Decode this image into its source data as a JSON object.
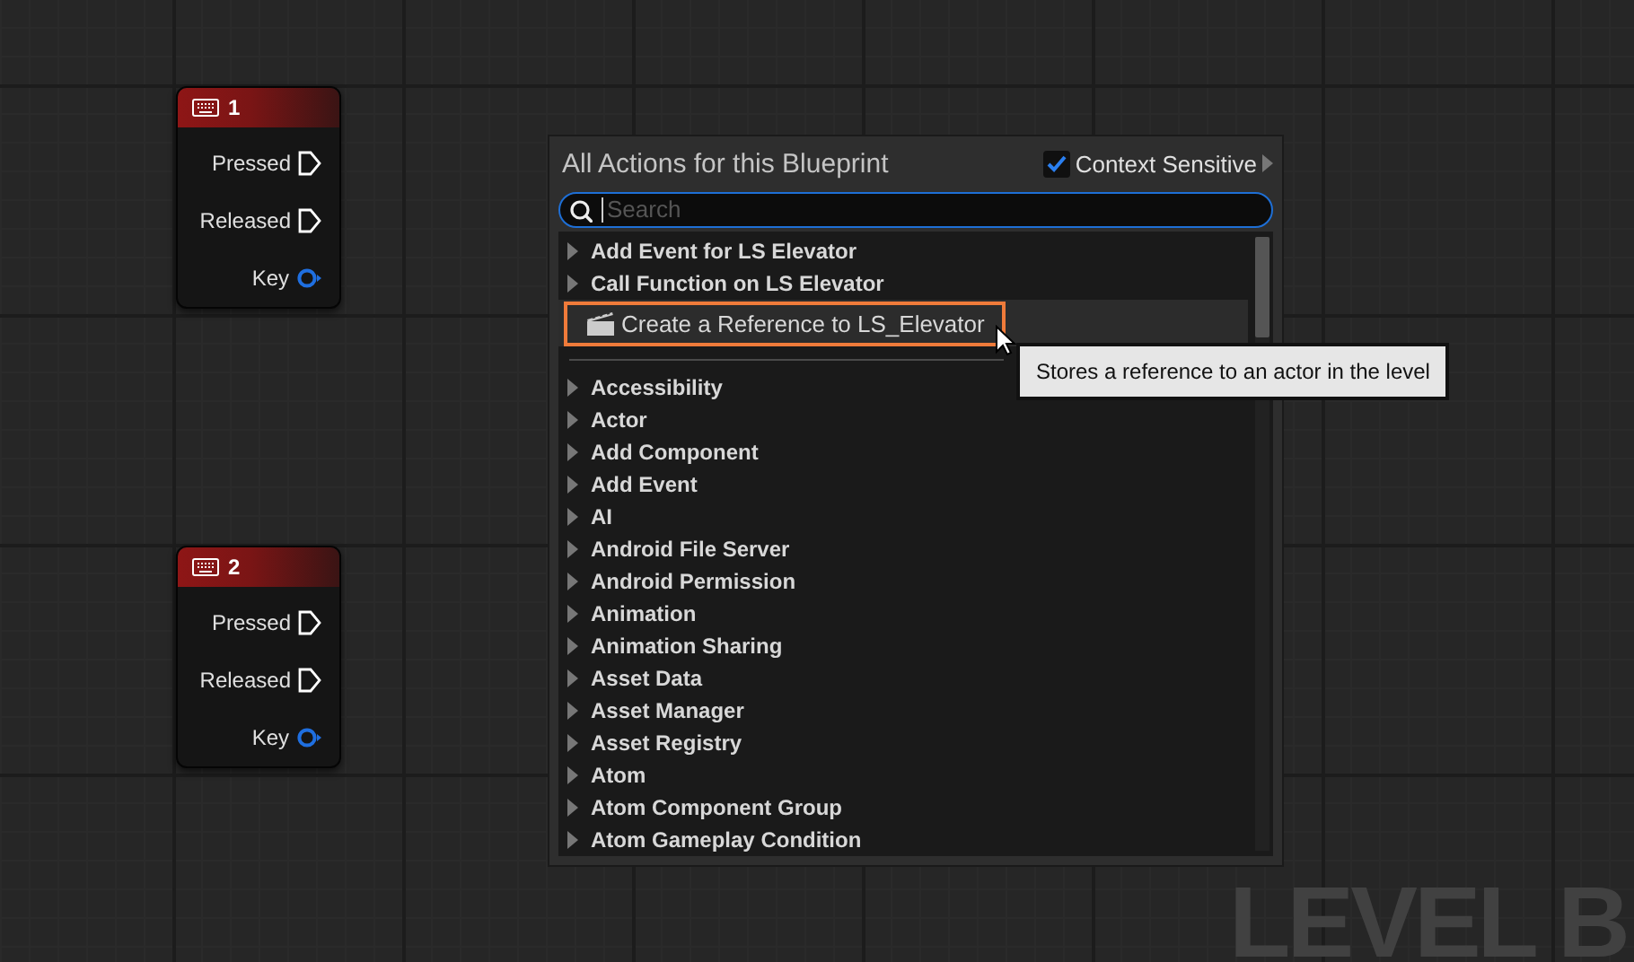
{
  "graph_nodes": [
    {
      "title": "1",
      "pins": [
        {
          "label": "Pressed",
          "kind": "exec"
        },
        {
          "label": "Released",
          "kind": "exec"
        },
        {
          "label": "Key",
          "kind": "key"
        }
      ]
    },
    {
      "title": "2",
      "pins": [
        {
          "label": "Pressed",
          "kind": "exec"
        },
        {
          "label": "Released",
          "kind": "exec"
        },
        {
          "label": "Key",
          "kind": "key"
        }
      ]
    }
  ],
  "action_menu": {
    "title": "All Actions for this Blueprint",
    "context_sensitive": {
      "label": "Context Sensitive",
      "checked": true
    },
    "search": {
      "placeholder": "Search"
    },
    "sections": [
      {
        "items": [
          {
            "label": "Add Event for LS Elevator",
            "kind": "category",
            "expanded": false,
            "selected": false
          },
          {
            "label": "Call Function on LS Elevator",
            "kind": "category",
            "expanded": false,
            "selected": false
          },
          {
            "label": "Create a Reference to LS_Elevator",
            "kind": "action",
            "selected": true
          }
        ]
      },
      {
        "items": [
          {
            "label": "Accessibility",
            "kind": "category",
            "expanded": false,
            "selected": false
          },
          {
            "label": "Actor",
            "kind": "category",
            "expanded": false,
            "selected": false
          },
          {
            "label": "Add Component",
            "kind": "category",
            "expanded": false,
            "selected": false
          },
          {
            "label": "Add Event",
            "kind": "category",
            "expanded": false,
            "selected": false
          },
          {
            "label": "AI",
            "kind": "category",
            "expanded": false,
            "selected": false
          },
          {
            "label": "Android File Server",
            "kind": "category",
            "expanded": false,
            "selected": false
          },
          {
            "label": "Android Permission",
            "kind": "category",
            "expanded": false,
            "selected": false
          },
          {
            "label": "Animation",
            "kind": "category",
            "expanded": false,
            "selected": false
          },
          {
            "label": "Animation Sharing",
            "kind": "category",
            "expanded": false,
            "selected": false
          },
          {
            "label": "Asset Data",
            "kind": "category",
            "expanded": false,
            "selected": false
          },
          {
            "label": "Asset Manager",
            "kind": "category",
            "expanded": false,
            "selected": false
          },
          {
            "label": "Asset Registry",
            "kind": "category",
            "expanded": false,
            "selected": false
          },
          {
            "label": "Atom",
            "kind": "category",
            "expanded": false,
            "selected": false
          },
          {
            "label": "Atom Component Group",
            "kind": "category",
            "expanded": false,
            "selected": false
          },
          {
            "label": "Atom Gameplay Condition",
            "kind": "category",
            "expanded": false,
            "selected": false
          }
        ]
      }
    ]
  },
  "tooltip": {
    "text": "Stores a reference to an actor in the level"
  },
  "canvas_label": "LEVEL B"
}
